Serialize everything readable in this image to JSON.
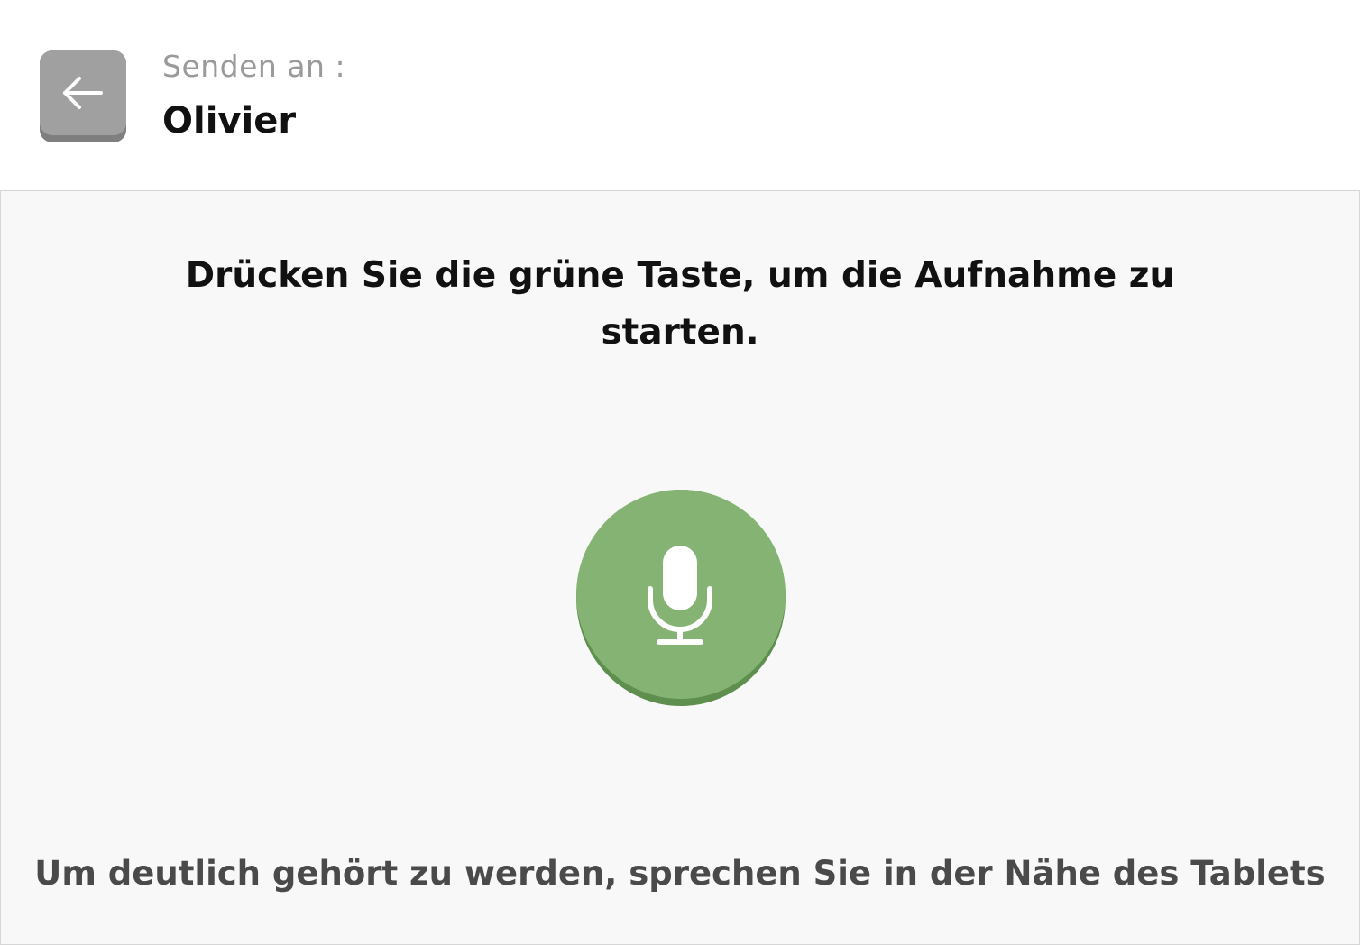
{
  "header": {
    "back_icon": "arrow-left-icon",
    "recipient_label": "Senden an :",
    "recipient_name": "Olivier"
  },
  "main": {
    "instruction": "Drücken Sie die grüne Taste, um die Aufnahme zu starten.",
    "record_icon": "microphone-icon",
    "hint": "Um deutlich gehört zu werden, sprechen Sie in der Nähe des Tablets"
  },
  "colors": {
    "back_button": "#a0a0a0",
    "record_button": "#84b373",
    "panel_background": "#f8f8f8"
  }
}
